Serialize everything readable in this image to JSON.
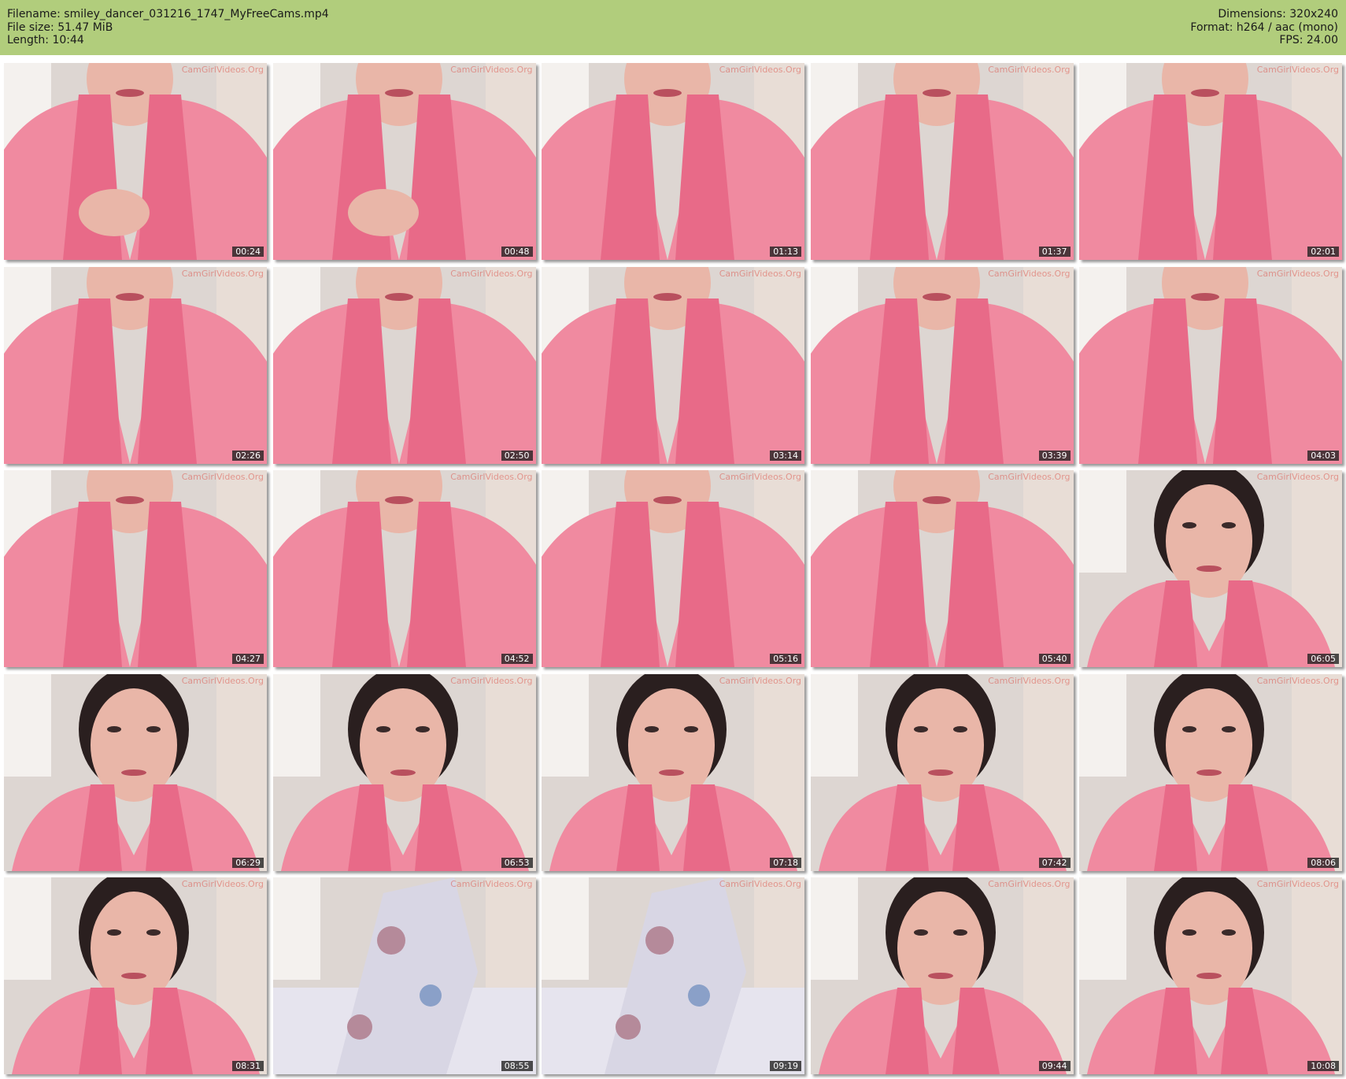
{
  "header": {
    "filename": "Filename: smiley_dancer_031216_1747_MyFreeCams.mp4",
    "file_size": "File size: 51.47 MiB",
    "length": "Length: 10:44",
    "dimensions": "Dimensions: 320x240",
    "format": "Format: h264 / aac (mono)",
    "fps": "FPS: 24.00"
  },
  "watermark": "CamGirlVideos.Org",
  "thumbnails": [
    {
      "time": "00:24"
    },
    {
      "time": "00:48"
    },
    {
      "time": "01:13"
    },
    {
      "time": "01:37"
    },
    {
      "time": "02:01"
    },
    {
      "time": "02:26"
    },
    {
      "time": "02:50"
    },
    {
      "time": "03:14"
    },
    {
      "time": "03:39"
    },
    {
      "time": "04:03"
    },
    {
      "time": "04:27"
    },
    {
      "time": "04:52"
    },
    {
      "time": "05:16"
    },
    {
      "time": "05:40"
    },
    {
      "time": "06:05"
    },
    {
      "time": "06:29"
    },
    {
      "time": "06:53"
    },
    {
      "time": "07:18"
    },
    {
      "time": "07:42"
    },
    {
      "time": "08:06"
    },
    {
      "time": "08:31"
    },
    {
      "time": "08:55"
    },
    {
      "time": "09:19"
    },
    {
      "time": "09:44"
    },
    {
      "time": "10:08"
    }
  ]
}
